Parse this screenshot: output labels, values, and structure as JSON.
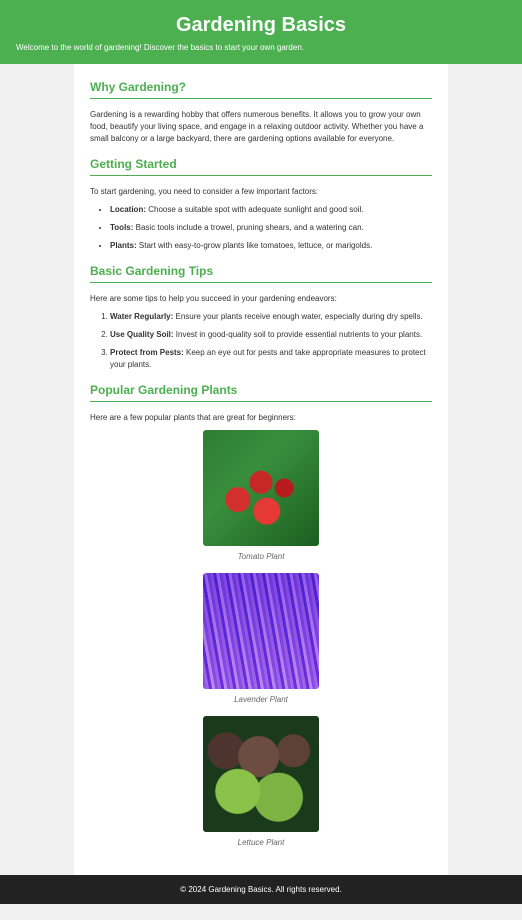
{
  "header": {
    "title": "Gardening Basics",
    "subtitle": "Welcome to the world of gardening! Discover the basics to start your own garden."
  },
  "sections": {
    "why": {
      "heading": "Why Gardening?",
      "text": "Gardening is a rewarding hobby that offers numerous benefits. It allows you to grow your own food, beautify your living space, and engage in a relaxing outdoor activity. Whether you have a small balcony or a large backyard, there are gardening options available for everyone."
    },
    "getting_started": {
      "heading": "Getting Started",
      "intro": "To start gardening, you need to consider a few important factors:",
      "items": [
        {
          "label": "Location:",
          "text": " Choose a suitable spot with adequate sunlight and good soil."
        },
        {
          "label": "Tools:",
          "text": " Basic tools include a trowel, pruning shears, and a watering can."
        },
        {
          "label": "Plants:",
          "text": " Start with easy-to-grow plants like tomatoes, lettuce, or marigolds."
        }
      ]
    },
    "tips": {
      "heading": "Basic Gardening Tips",
      "intro": "Here are some tips to help you succeed in your gardening endeavors:",
      "items": [
        {
          "label": "Water Regularly:",
          "text": " Ensure your plants receive enough water, especially during dry spells."
        },
        {
          "label": "Use Quality Soil:",
          "text": " Invest in good-quality soil to provide essential nutrients to your plants."
        },
        {
          "label": "Protect from Pests:",
          "text": " Keep an eye out for pests and take appropriate measures to protect your plants."
        }
      ]
    },
    "plants": {
      "heading": "Popular Gardening Plants",
      "intro": "Here are a few popular plants that are great for beginners:",
      "items": [
        {
          "caption": "Tomato Plant"
        },
        {
          "caption": "Lavender Plant"
        },
        {
          "caption": "Lettuce Plant"
        }
      ]
    }
  },
  "footer": "© 2024 Gardening Basics. All rights reserved."
}
